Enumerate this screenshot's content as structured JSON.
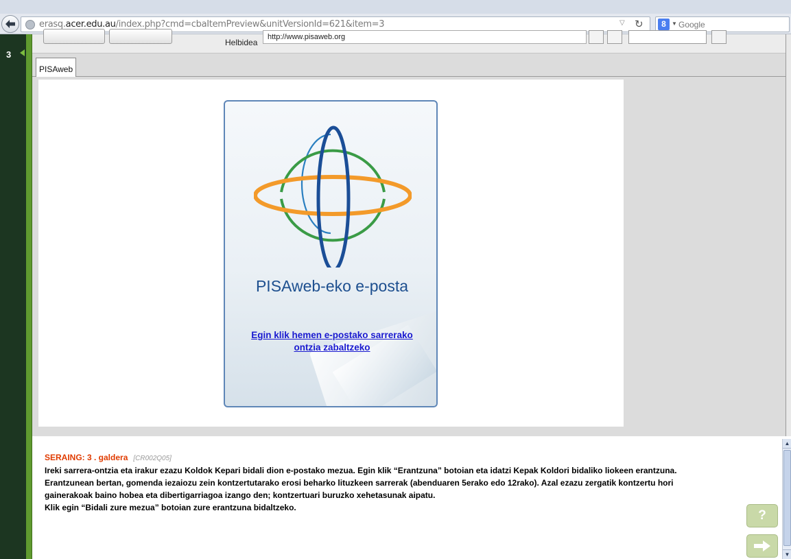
{
  "browser": {
    "url_prefix": "erasq.",
    "url_domain": "acer.edu.au",
    "url_path": "/index.php?cmd=cbaItemPreview&unitVersionId=621&item=3",
    "search_placeholder": "Google",
    "search_engine_letter": "8"
  },
  "sidebar": {
    "number": "3"
  },
  "toolbar": {
    "address_label": "Helbidea",
    "address_value": "http://www.pisaweb.org"
  },
  "tabs": [
    {
      "label": "PISAweb"
    }
  ],
  "card": {
    "title": "PISAweb-eko e-posta",
    "link_line1": "Egin klik hemen e-postako sarrerako",
    "link_line2": "ontzia zabaltzeko"
  },
  "question": {
    "heading": "SERAING: 3 . galdera",
    "code": "[CR002Q05]",
    "line1": "Ireki sarrera-ontzia eta irakur ezazu Koldok Kepari bidali dion e-postako mezua. Egin klik “Erantzuna” botoian eta idatzi Kepak Koldori bidaliko liokeen erantzuna.",
    "line2": "Erantzunean bertan, gomenda iezaiozu zein kontzertutarako erosi beharko lituzkeen sarrerak (abenduaren 5erako edo 12rako). Azal ezazu zergatik kontzertu hori",
    "line3": "gainerakoak baino hobea eta dibertigarriagoa izango den; kontzertuari buruzko xehetasunak aipatu.",
    "line4": "Klik egin “Bidali zure mezua” botoian zure erantzuna bidaltzeko."
  },
  "help_label": "?",
  "colors": {
    "sidebar_dark": "#1c3621",
    "sidebar_green": "#5f9a2f",
    "heading_red": "#e03b00",
    "card_blue": "#1d4f8f",
    "link_blue": "#1a1ad0"
  }
}
